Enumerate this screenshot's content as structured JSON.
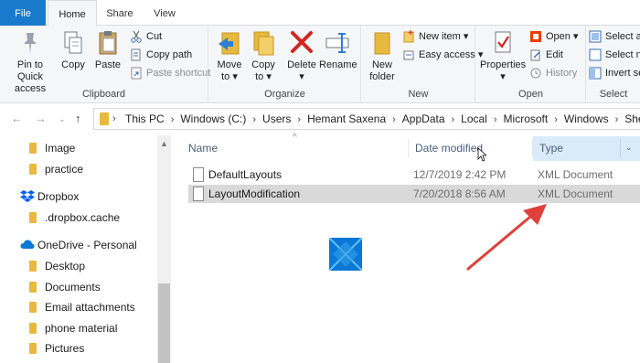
{
  "tabs": [
    {
      "label": "File"
    },
    {
      "label": "Home"
    },
    {
      "label": "Share"
    },
    {
      "label": "View"
    }
  ],
  "ribbon": {
    "clipboard": {
      "label": "Clipboard",
      "pin": "Pin to Quick access",
      "pin_line1": "Pin to Quick",
      "pin_line2": "access",
      "copy": "Copy",
      "paste": "Paste",
      "cut": "Cut",
      "copy_path": "Copy path",
      "paste_shortcut": "Paste shortcut"
    },
    "organize": {
      "label": "Organize",
      "move_to_1": "Move",
      "move_to_2": "to",
      "copy_to_1": "Copy",
      "copy_to_2": "to",
      "delete": "Delete",
      "rename": "Rename"
    },
    "new": {
      "label": "New",
      "new_folder_1": "New",
      "new_folder_2": "folder",
      "new_item": "New item",
      "easy_access": "Easy access"
    },
    "open": {
      "label": "Open",
      "properties": "Properties",
      "open": "Open",
      "edit": "Edit",
      "history": "History"
    },
    "select": {
      "label": "Select",
      "select_all": "Select all",
      "select_none": "Select no",
      "invert": "Invert sel"
    }
  },
  "address": {
    "crumbs": [
      "This PC",
      "Windows (C:)",
      "Users",
      "Hemant Saxena",
      "AppData",
      "Local",
      "Microsoft",
      "Windows",
      "Shell"
    ]
  },
  "navpane": {
    "items": [
      {
        "label": "Image",
        "kind": "folder"
      },
      {
        "label": "practice",
        "kind": "folder"
      },
      {
        "label": "Dropbox",
        "kind": "dropbox"
      },
      {
        "label": ".dropbox.cache",
        "kind": "folder"
      },
      {
        "label": "OneDrive - Personal",
        "kind": "onedrive"
      },
      {
        "label": "Desktop",
        "kind": "folder"
      },
      {
        "label": "Documents",
        "kind": "folder"
      },
      {
        "label": "Email attachments",
        "kind": "folder"
      },
      {
        "label": "phone material",
        "kind": "folder"
      },
      {
        "label": "Pictures",
        "kind": "folder"
      }
    ]
  },
  "filelist": {
    "columns": {
      "name": "Name",
      "date": "Date modified",
      "type": "Type"
    },
    "rows": [
      {
        "name": "DefaultLayouts",
        "date": "12/7/2019 2:42 PM",
        "type": "XML Document"
      },
      {
        "name": "LayoutModification",
        "date": "7/20/2018 8:56 AM",
        "type": "XML Document"
      }
    ]
  },
  "colors": {
    "accent": "#1979ca",
    "selected_row": "#d9d9d9",
    "arrow": "#e0403a",
    "folder": "#e8b93f"
  }
}
